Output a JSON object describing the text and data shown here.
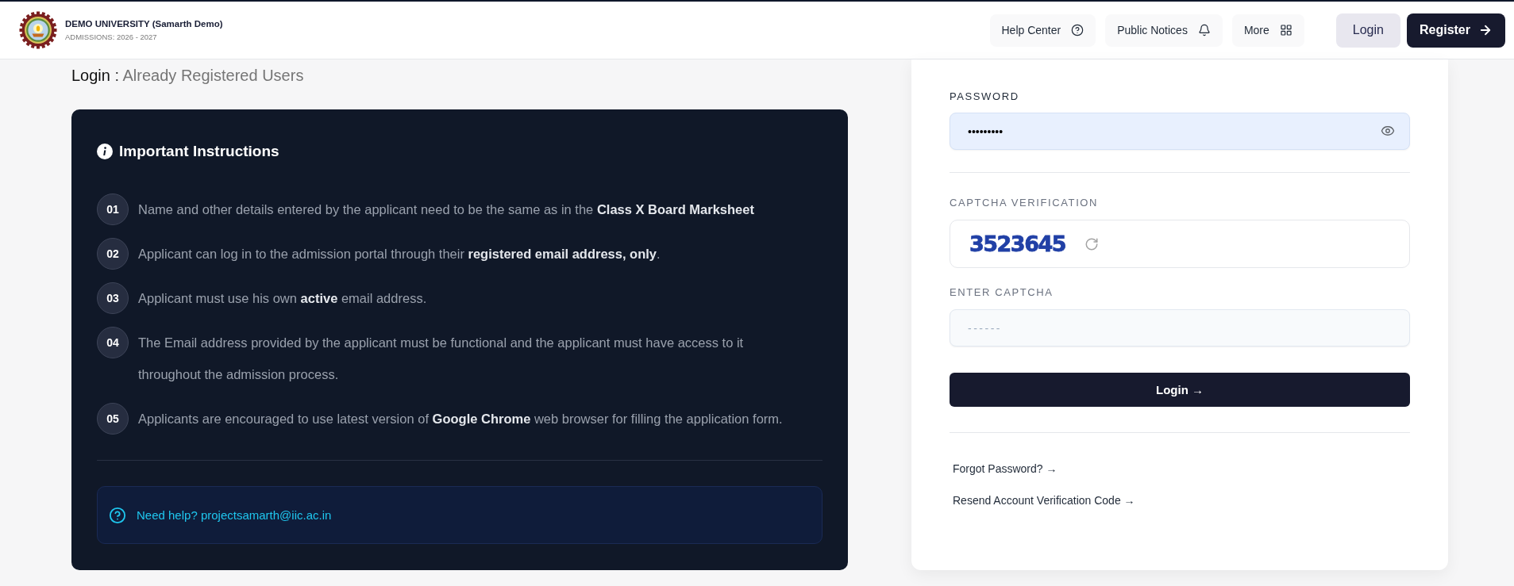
{
  "header": {
    "university_name": "DEMO UNIVERSITY (Samarth Demo)",
    "session": "ADMISSIONS: 2026 - 2027",
    "nav": [
      {
        "label": "Help Center"
      },
      {
        "label": "Public Notices"
      },
      {
        "label": "More"
      }
    ],
    "actions": [
      {
        "label": "Login",
        "kind": "secondary"
      },
      {
        "label": "Register",
        "kind": "primary"
      }
    ]
  },
  "heading": {
    "title": "Login",
    "separator": ":",
    "subtitle": "Already Registered Users"
  },
  "instructions": {
    "title": "Important Instructions",
    "items": [
      {
        "number": "01",
        "text": "Name and other details entered by the applicant need to be the same as in the **Class X Board Marksheet**"
      },
      {
        "number": "02",
        "text": "Applicant can log in to the admission portal through their **registered email address, only**."
      },
      {
        "number": "03",
        "text": "Applicant must use his own **active** email address."
      },
      {
        "number": "04",
        "text": "The Email address provided by the applicant must be functional and the applicant must have access to it throughout the admission process."
      },
      {
        "number": "05",
        "text": "Applicants are encouraged to use latest version of **Google Chrome** web browser for filling the application form."
      }
    ],
    "help": "Need help? projectsamarth@iic.ac.in"
  },
  "login_form": {
    "password": {
      "label": "PASSWORD",
      "value": "•••••••••",
      "autofilled": true
    },
    "captcha": {
      "label": "CAPTCHA VERIFICATION",
      "code": "3523645"
    },
    "captcha_entry": {
      "label": "ENTER CAPTCHA",
      "placeholder": "------"
    },
    "submit": "Login →",
    "links": [
      "Forgot Password? →",
      "Resend Account Verification Code →"
    ]
  }
}
